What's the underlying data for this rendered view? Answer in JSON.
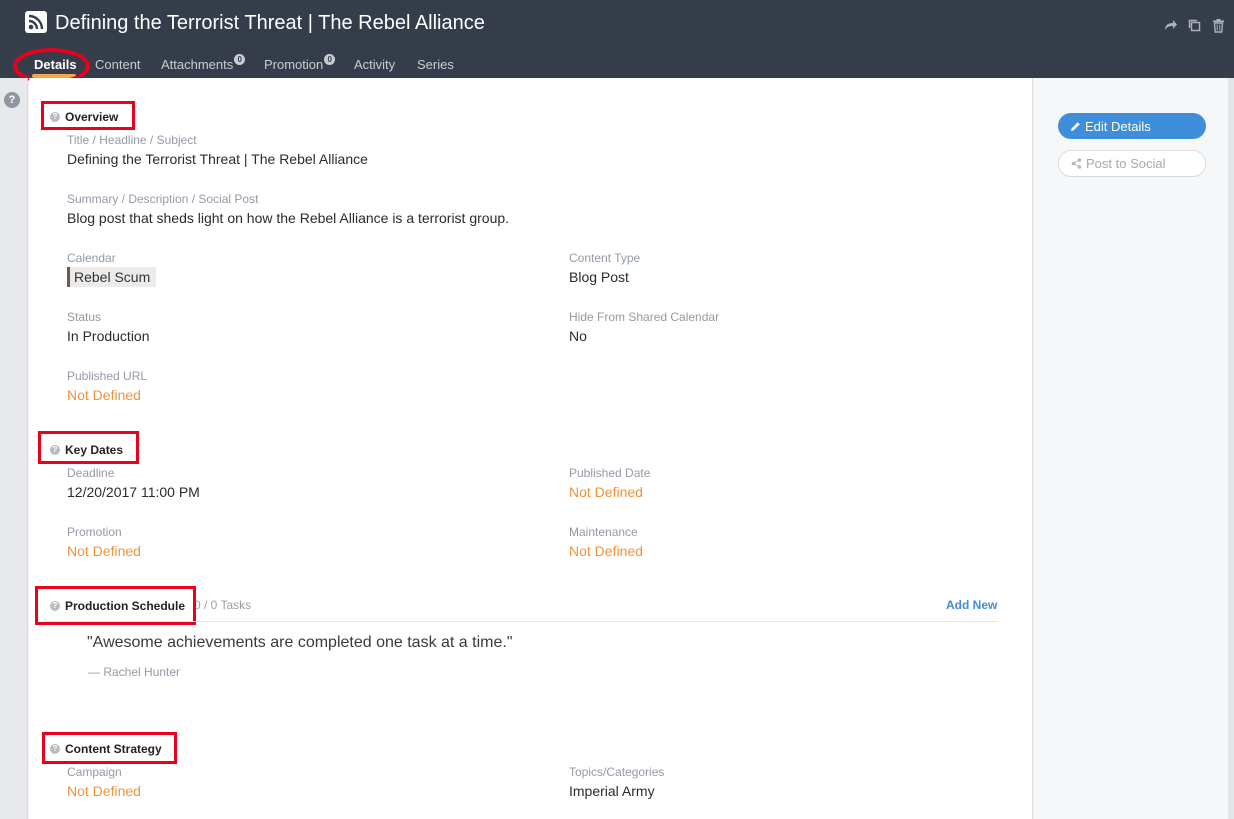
{
  "header": {
    "title": "Defining the Terrorist Threat | The Rebel Alliance"
  },
  "tabs": [
    {
      "label": "Details"
    },
    {
      "label": "Content"
    },
    {
      "label": "Attachments",
      "badge": "0"
    },
    {
      "label": "Promotion",
      "badge": "0"
    },
    {
      "label": "Activity"
    },
    {
      "label": "Series"
    }
  ],
  "sidebar": {
    "help": "?"
  },
  "overview": {
    "title": "Overview",
    "title_label": "Title / Headline / Subject",
    "title_value": "Defining the Terrorist Threat | The Rebel Alliance",
    "summary_label": "Summary / Description / Social Post",
    "summary_value": "Blog post that sheds light on how the Rebel Alliance is a terrorist group.",
    "calendar_label": "Calendar",
    "calendar_value": "Rebel Scum",
    "content_type_label": "Content Type",
    "content_type_value": "Blog Post",
    "status_label": "Status",
    "status_value": "In Production",
    "hide_label": "Hide From Shared Calendar",
    "hide_value": "No",
    "url_label": "Published URL",
    "url_value": "Not Defined"
  },
  "key_dates": {
    "title": "Key Dates",
    "deadline_label": "Deadline",
    "deadline_value": "12/20/2017 11:00 PM",
    "published_label": "Published Date",
    "published_value": "Not Defined",
    "promotion_label": "Promotion",
    "promotion_value": "Not Defined",
    "maintenance_label": "Maintenance",
    "maintenance_value": "Not Defined"
  },
  "production": {
    "title": "Production Schedule",
    "tasks": "0 / 0 Tasks",
    "add_new": "Add New",
    "quote": "\"Awesome achievements are completed one task at a time.\"",
    "author": "—  Rachel Hunter"
  },
  "strategy": {
    "title": "Content Strategy",
    "campaign_label": "Campaign",
    "campaign_value": "Not Defined",
    "topics_label": "Topics/Categories",
    "topics_value": "Imperial Army"
  },
  "actions": {
    "edit": "Edit Details",
    "post": "Post to Social"
  },
  "colors": {
    "header_bg": "#363d4a",
    "accent_blue": "#3f8edb",
    "not_defined_orange": "#f0923a",
    "highlight_red": "#e8001c"
  },
  "icons": [
    "rss-icon",
    "share-icon",
    "copy-icon",
    "trash-icon",
    "help-icon",
    "pencil-icon",
    "share-nodes-icon"
  ]
}
